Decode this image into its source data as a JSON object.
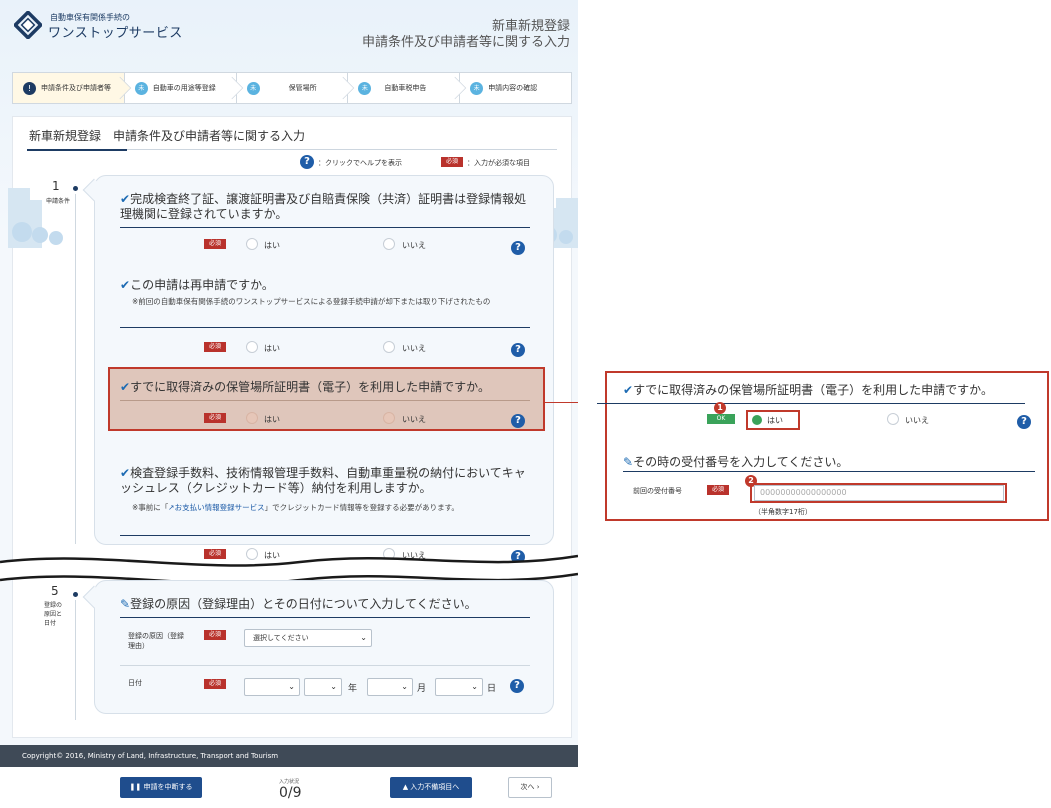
{
  "header": {
    "logo_small": "自動車保有関係手続の",
    "logo_big": "ワンストップサービス",
    "title_line1": "新車新規登録",
    "title_line2": "申請条件及び申請者等に関する入力"
  },
  "steps": [
    {
      "label": "申請条件及び申請者等",
      "mark": "!"
    },
    {
      "label": "自動車の用途等登録",
      "mark": "未"
    },
    {
      "label": "保管場所",
      "mark": "未"
    },
    {
      "label": "自動車税申告",
      "mark": "未"
    },
    {
      "label": "申請内容の確認",
      "mark": "未"
    }
  ],
  "panel": {
    "title": "新車新規登録　申請条件及び申請者等に関する入力",
    "legend_help": "：クリックでヘルプを表示",
    "legend_req_badge": "必須",
    "legend_req_text": "：入力が必須な項目"
  },
  "sections": {
    "s1": {
      "num": "1",
      "label": "申請条件"
    },
    "s5": {
      "num": "5",
      "label": "登録の原因と日付"
    }
  },
  "questions": {
    "q1": {
      "text": "完成検査終了証、譲渡証明書及び自賠責保険（共済）証明書は登録情報処理機関に登録されていますか。"
    },
    "q2": {
      "text": "この申請は再申請ですか。",
      "note": "※前回の自動車保有関係手続のワンストップサービスによる登録手続申請が却下または取り下げされたもの"
    },
    "q3": {
      "text": "すでに取得済みの保管場所証明書（電子）を利用した申請ですか。"
    },
    "q4": {
      "text": "検査登録手数料、技術情報管理手数料、自動車重量税の納付においてキャッシュレス（クレジットカード等）納付を利用しますか。",
      "note_pre": "※事前に「",
      "note_link": "お支払い情報登録サービス",
      "note_post": "」でクレジットカード情報等を登録する必要があります。"
    },
    "q5": {
      "text": "登録の原因（登録理由）とその日付について入力してください。"
    }
  },
  "common": {
    "req_badge": "必須",
    "yes": "はい",
    "no": "いいえ",
    "help": "?"
  },
  "date_form": {
    "reason_label": "登録の原因（登録理由）",
    "reason_placeholder": "選択してください",
    "date_label": "日付",
    "unit_year": "年",
    "unit_month": "月",
    "unit_day": "日"
  },
  "footer": {
    "copyright": "Copyright© 2016, Ministry of Land, Infrastructure, Transport and Tourism"
  },
  "bottombar": {
    "suspend": "申請を中断する",
    "progress_label": "入力状況",
    "progress_value": "0/9",
    "jump": "入力不備項目へ",
    "next": "次へ"
  },
  "zoom": {
    "q3_text": "すでに取得済みの保管場所証明書（電子）を利用した申請ですか。",
    "ok_badge": "OK",
    "yes": "はい",
    "no": "いいえ",
    "callout1": "1",
    "callout2": "2",
    "q_receipt": "その時の受付番号を入力してください。",
    "receipt_label": "前回の受付番号",
    "receipt_placeholder": "00000000000000000",
    "receipt_hint": "（半角数字17桁）"
  },
  "colors": {
    "brand": "#1d3b63",
    "required": "#b9322c",
    "ok": "#3aa35a",
    "highlight": "#c0392b",
    "help": "#1f5da8"
  }
}
